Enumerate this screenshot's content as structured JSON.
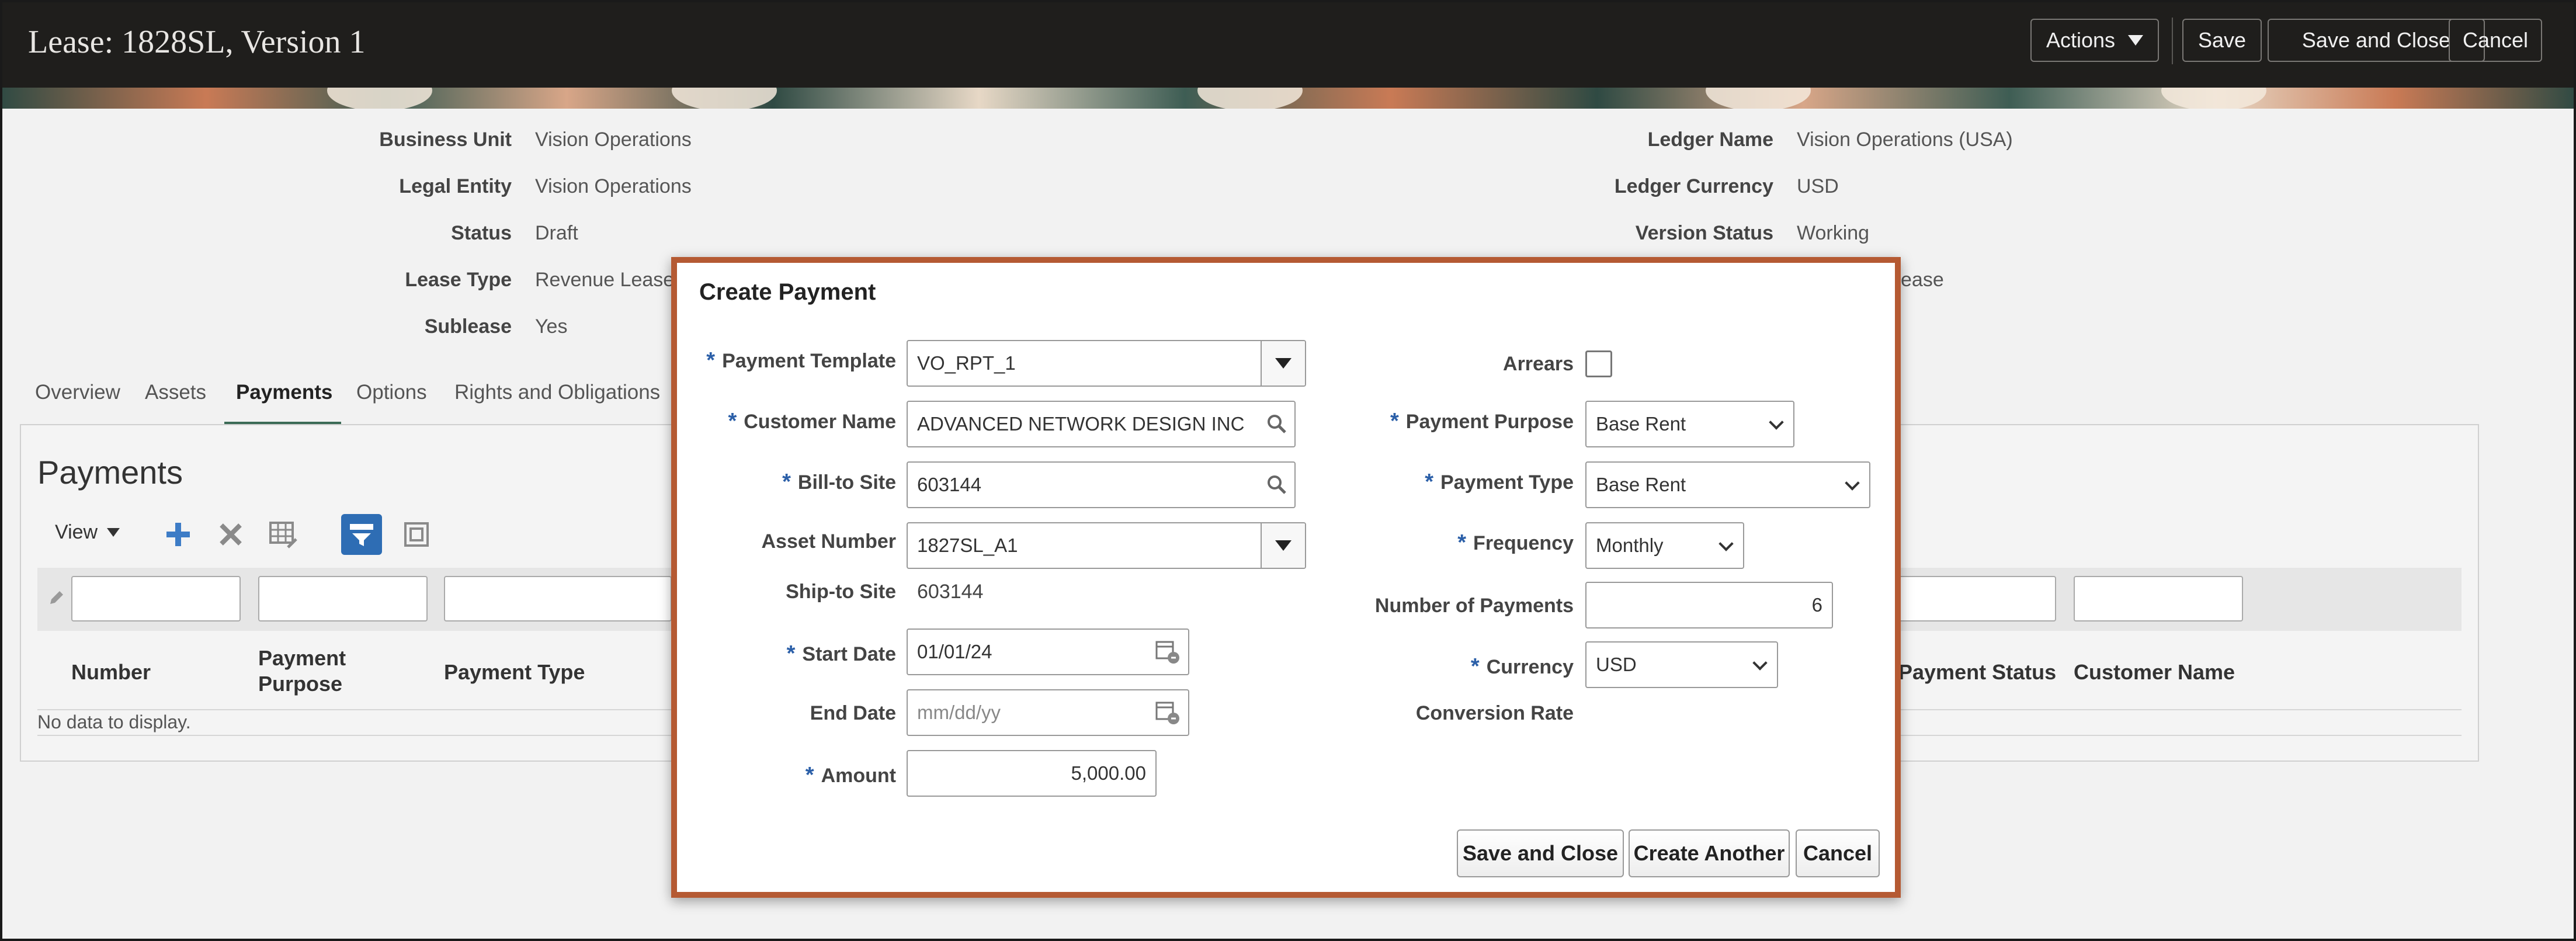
{
  "header": {
    "title": "Lease: 1828SL, Version 1",
    "actions_label": "Actions",
    "save_label": "Save",
    "save_close_label": "Save and Close",
    "cancel_label": "Cancel"
  },
  "summary": {
    "left": [
      {
        "label": "Business Unit",
        "value": "Vision Operations"
      },
      {
        "label": "Legal Entity",
        "value": "Vision Operations"
      },
      {
        "label": "Status",
        "value": "Draft"
      },
      {
        "label": "Lease Type",
        "value": "Revenue Lease"
      },
      {
        "label": "Sublease",
        "value": "Yes"
      }
    ],
    "right": [
      {
        "label": "Ledger Name",
        "value": "Vision Operations (USA)"
      },
      {
        "label": "Ledger Currency",
        "value": "USD"
      },
      {
        "label": "Version Status",
        "value": "Working"
      }
    ],
    "partial_right_value": "ease"
  },
  "tabs": [
    "Overview",
    "Assets",
    "Payments",
    "Options",
    "Rights and Obligations"
  ],
  "payments": {
    "title": "Payments",
    "view_label": "View",
    "columns": {
      "number": "Number",
      "purpose_line1": "Payment",
      "purpose_line2": "Purpose",
      "type": "Payment Type",
      "status": "Payment Status",
      "customer": "Customer Name"
    },
    "empty_text": "No data to display."
  },
  "dialog": {
    "title": "Create Payment",
    "fields": {
      "payment_template": {
        "label": "Payment Template",
        "value": "VO_RPT_1"
      },
      "customer_name": {
        "label": "Customer Name",
        "value": "ADVANCED NETWORK DESIGN INC"
      },
      "bill_to_site": {
        "label": "Bill-to Site",
        "value": "603144"
      },
      "asset_number": {
        "label": "Asset Number",
        "value": "1827SL_A1"
      },
      "ship_to_site": {
        "label": "Ship-to Site",
        "value": "603144"
      },
      "start_date": {
        "label": "Start Date",
        "value": "01/01/24"
      },
      "end_date": {
        "label": "End Date",
        "placeholder": "mm/dd/yy"
      },
      "amount": {
        "label": "Amount",
        "value": "5,000.00"
      },
      "arrears": {
        "label": "Arrears",
        "checked": false
      },
      "payment_purpose": {
        "label": "Payment Purpose",
        "value": "Base Rent"
      },
      "payment_type": {
        "label": "Payment Type",
        "value": "Base Rent"
      },
      "frequency": {
        "label": "Frequency",
        "value": "Monthly"
      },
      "number_of_payments": {
        "label": "Number of Payments",
        "value": "6"
      },
      "currency": {
        "label": "Currency",
        "value": "USD"
      },
      "conversion_rate": {
        "label": "Conversion Rate"
      }
    },
    "buttons": {
      "save_close": "Save and Close",
      "create_another": "Create Another",
      "cancel": "Cancel"
    }
  },
  "colors": {
    "header_bg": "#1f1e1c",
    "dialog_border": "#b55a33",
    "required_marker": "#2b5fa8",
    "tab_active_underline": "#3b6b56",
    "toolbar_accent": "#2e6db4"
  }
}
